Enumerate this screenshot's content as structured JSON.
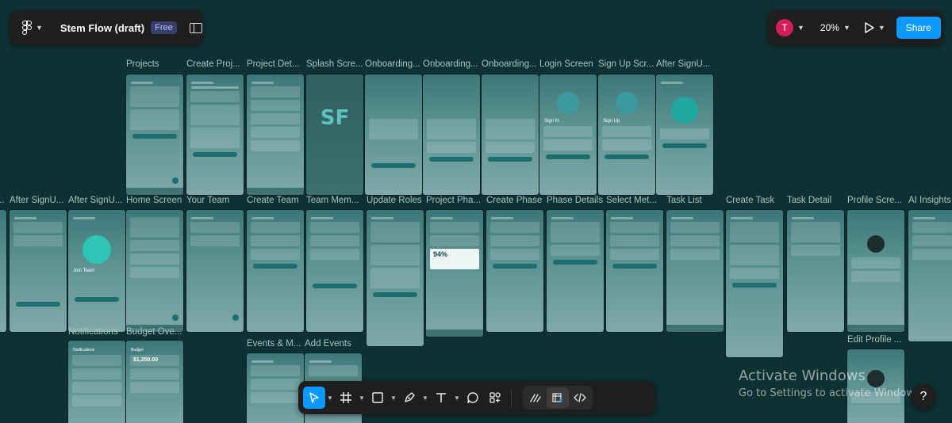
{
  "file": {
    "name": "Stem Flow (draft)",
    "plan_badge": "Free"
  },
  "user": {
    "avatar_initial": "T"
  },
  "zoom": {
    "level": "20%"
  },
  "share": {
    "label": "Share"
  },
  "frames": {
    "row1": [
      "Projects",
      "Create Proj...",
      "Project Det...",
      "Splash Scre...",
      "Onboarding...",
      "Onboarding...",
      "Onboarding...",
      "Login Screen",
      "Sign Up Scr...",
      "After SignU..."
    ],
    "row2": [
      "After SignU...",
      "After SignU...",
      "Home Screen",
      "Your Team",
      "Create Team",
      "Team Mem...",
      "Update Roles",
      "Project Pha...",
      "Create Phase",
      "Phase Details",
      "Select Met...",
      "Task List",
      "Create Task",
      "Task Detail",
      "Profile Scre...",
      "AI Insights"
    ],
    "row3": [
      "Notifications",
      "Budget Ove...",
      "Events & M...",
      "Add Events",
      "Edit Profile ..."
    ]
  },
  "frame_content": {
    "sign_in": "Sign In",
    "sign_up": "Sign Up",
    "join_team": "Join Team",
    "budget_amount": "$1,250.00",
    "phase_percent": "94%",
    "notifications_title": "Notifications",
    "budget_title": "Budget"
  },
  "toolbar": {
    "tools": [
      "move-tool",
      "frame-tool",
      "shape-tool",
      "pen-tool",
      "text-tool",
      "comment-tool",
      "actions-tool"
    ],
    "modes": [
      "draw-mode",
      "design-mode",
      "dev-mode"
    ],
    "active_tool": "move-tool",
    "selected_mode": "design-mode"
  },
  "watermark": {
    "title": "Activate Windows",
    "subtitle": "Go to Settings to activate Windows."
  },
  "help": {
    "label": "?"
  },
  "colors": {
    "canvas": "#0e3134",
    "accent": "#0d99ff",
    "panel": "#1e1e1e",
    "avatar": "#d11e5a"
  }
}
